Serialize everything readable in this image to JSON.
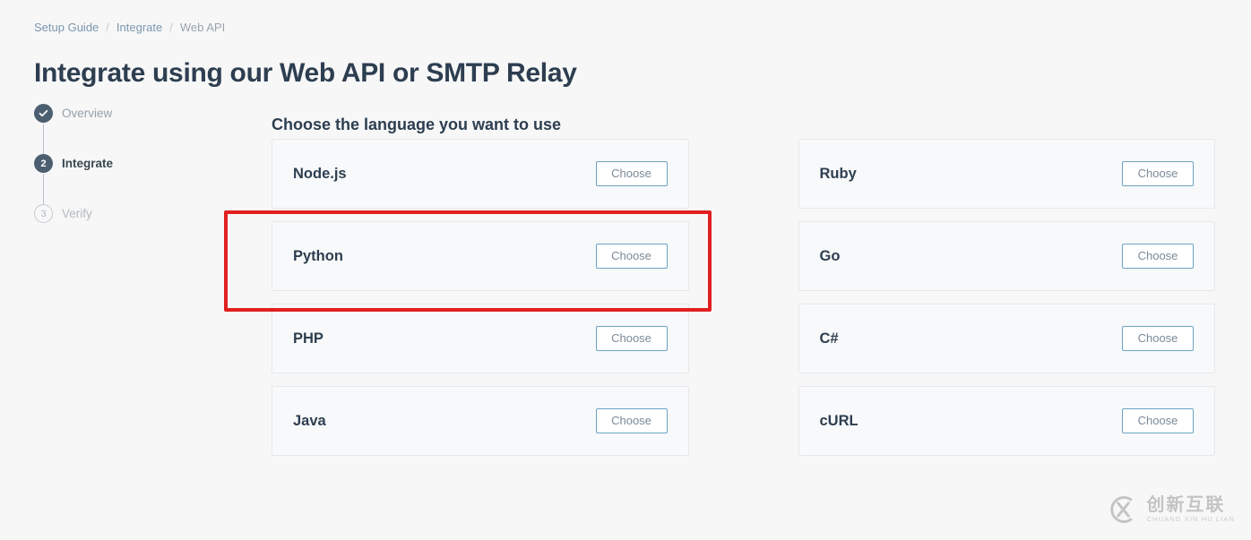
{
  "breadcrumb": {
    "items": [
      {
        "label": "Setup Guide",
        "type": "link"
      },
      {
        "label": "Integrate",
        "type": "link"
      },
      {
        "label": "Web API",
        "type": "current"
      }
    ],
    "separator": "/"
  },
  "page_title": "Integrate using our Web API or SMTP Relay",
  "stepper": {
    "steps": [
      {
        "marker": "check-icon",
        "label": "Overview",
        "state": "done"
      },
      {
        "marker": "2",
        "label": "Integrate",
        "state": "active"
      },
      {
        "marker": "3",
        "label": "Verify",
        "state": "todo"
      }
    ]
  },
  "main": {
    "heading": "Choose the language you want to use",
    "choose_label": "Choose",
    "columns": [
      {
        "cards": [
          {
            "name": "Node.js",
            "button": "Choose"
          },
          {
            "name": "Python",
            "button": "Choose"
          },
          {
            "name": "PHP",
            "button": "Choose"
          },
          {
            "name": "Java",
            "button": "Choose"
          }
        ]
      },
      {
        "cards": [
          {
            "name": "Ruby",
            "button": "Choose"
          },
          {
            "name": "Go",
            "button": "Choose"
          },
          {
            "name": "C#",
            "button": "Choose"
          },
          {
            "name": "cURL",
            "button": "Choose"
          }
        ]
      }
    ]
  },
  "annotation": {
    "target": "Python",
    "color": "#e02020"
  },
  "watermark": {
    "chinese": "创新互联",
    "pinyin": "CHUANG XIN HU LIAN",
    "logo": "cx-logo-icon"
  },
  "colors": {
    "page_background": "#f7f7f7",
    "title": "#2d3e50",
    "link": "#7b96b0",
    "muted": "#9aa5b1",
    "card_background": "#f8f9fa",
    "card_border": "#e6e8ea",
    "button_border": "#6ba3c4",
    "button_text": "#7a8a9a",
    "step_active": "#4c5f70",
    "annotation": "#e02020"
  }
}
